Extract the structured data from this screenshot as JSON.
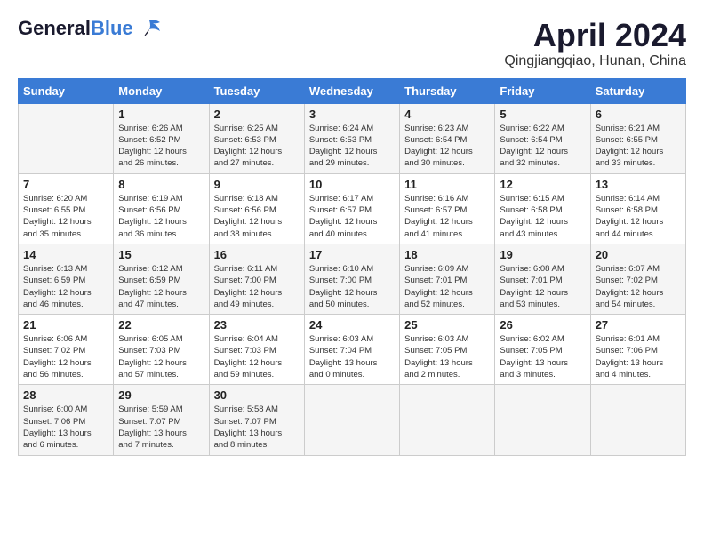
{
  "header": {
    "logo_line1": "General",
    "logo_line2": "Blue",
    "title": "April 2024",
    "subtitle": "Qingjiangqiao, Hunan, China"
  },
  "days_of_week": [
    "Sunday",
    "Monday",
    "Tuesday",
    "Wednesday",
    "Thursday",
    "Friday",
    "Saturday"
  ],
  "weeks": [
    [
      {
        "day": "",
        "info": ""
      },
      {
        "day": "1",
        "info": "Sunrise: 6:26 AM\nSunset: 6:52 PM\nDaylight: 12 hours\nand 26 minutes."
      },
      {
        "day": "2",
        "info": "Sunrise: 6:25 AM\nSunset: 6:53 PM\nDaylight: 12 hours\nand 27 minutes."
      },
      {
        "day": "3",
        "info": "Sunrise: 6:24 AM\nSunset: 6:53 PM\nDaylight: 12 hours\nand 29 minutes."
      },
      {
        "day": "4",
        "info": "Sunrise: 6:23 AM\nSunset: 6:54 PM\nDaylight: 12 hours\nand 30 minutes."
      },
      {
        "day": "5",
        "info": "Sunrise: 6:22 AM\nSunset: 6:54 PM\nDaylight: 12 hours\nand 32 minutes."
      },
      {
        "day": "6",
        "info": "Sunrise: 6:21 AM\nSunset: 6:55 PM\nDaylight: 12 hours\nand 33 minutes."
      }
    ],
    [
      {
        "day": "7",
        "info": "Sunrise: 6:20 AM\nSunset: 6:55 PM\nDaylight: 12 hours\nand 35 minutes."
      },
      {
        "day": "8",
        "info": "Sunrise: 6:19 AM\nSunset: 6:56 PM\nDaylight: 12 hours\nand 36 minutes."
      },
      {
        "day": "9",
        "info": "Sunrise: 6:18 AM\nSunset: 6:56 PM\nDaylight: 12 hours\nand 38 minutes."
      },
      {
        "day": "10",
        "info": "Sunrise: 6:17 AM\nSunset: 6:57 PM\nDaylight: 12 hours\nand 40 minutes."
      },
      {
        "day": "11",
        "info": "Sunrise: 6:16 AM\nSunset: 6:57 PM\nDaylight: 12 hours\nand 41 minutes."
      },
      {
        "day": "12",
        "info": "Sunrise: 6:15 AM\nSunset: 6:58 PM\nDaylight: 12 hours\nand 43 minutes."
      },
      {
        "day": "13",
        "info": "Sunrise: 6:14 AM\nSunset: 6:58 PM\nDaylight: 12 hours\nand 44 minutes."
      }
    ],
    [
      {
        "day": "14",
        "info": "Sunrise: 6:13 AM\nSunset: 6:59 PM\nDaylight: 12 hours\nand 46 minutes."
      },
      {
        "day": "15",
        "info": "Sunrise: 6:12 AM\nSunset: 6:59 PM\nDaylight: 12 hours\nand 47 minutes."
      },
      {
        "day": "16",
        "info": "Sunrise: 6:11 AM\nSunset: 7:00 PM\nDaylight: 12 hours\nand 49 minutes."
      },
      {
        "day": "17",
        "info": "Sunrise: 6:10 AM\nSunset: 7:00 PM\nDaylight: 12 hours\nand 50 minutes."
      },
      {
        "day": "18",
        "info": "Sunrise: 6:09 AM\nSunset: 7:01 PM\nDaylight: 12 hours\nand 52 minutes."
      },
      {
        "day": "19",
        "info": "Sunrise: 6:08 AM\nSunset: 7:01 PM\nDaylight: 12 hours\nand 53 minutes."
      },
      {
        "day": "20",
        "info": "Sunrise: 6:07 AM\nSunset: 7:02 PM\nDaylight: 12 hours\nand 54 minutes."
      }
    ],
    [
      {
        "day": "21",
        "info": "Sunrise: 6:06 AM\nSunset: 7:02 PM\nDaylight: 12 hours\nand 56 minutes."
      },
      {
        "day": "22",
        "info": "Sunrise: 6:05 AM\nSunset: 7:03 PM\nDaylight: 12 hours\nand 57 minutes."
      },
      {
        "day": "23",
        "info": "Sunrise: 6:04 AM\nSunset: 7:03 PM\nDaylight: 12 hours\nand 59 minutes."
      },
      {
        "day": "24",
        "info": "Sunrise: 6:03 AM\nSunset: 7:04 PM\nDaylight: 13 hours\nand 0 minutes."
      },
      {
        "day": "25",
        "info": "Sunrise: 6:03 AM\nSunset: 7:05 PM\nDaylight: 13 hours\nand 2 minutes."
      },
      {
        "day": "26",
        "info": "Sunrise: 6:02 AM\nSunset: 7:05 PM\nDaylight: 13 hours\nand 3 minutes."
      },
      {
        "day": "27",
        "info": "Sunrise: 6:01 AM\nSunset: 7:06 PM\nDaylight: 13 hours\nand 4 minutes."
      }
    ],
    [
      {
        "day": "28",
        "info": "Sunrise: 6:00 AM\nSunset: 7:06 PM\nDaylight: 13 hours\nand 6 minutes."
      },
      {
        "day": "29",
        "info": "Sunrise: 5:59 AM\nSunset: 7:07 PM\nDaylight: 13 hours\nand 7 minutes."
      },
      {
        "day": "30",
        "info": "Sunrise: 5:58 AM\nSunset: 7:07 PM\nDaylight: 13 hours\nand 8 minutes."
      },
      {
        "day": "",
        "info": ""
      },
      {
        "day": "",
        "info": ""
      },
      {
        "day": "",
        "info": ""
      },
      {
        "day": "",
        "info": ""
      }
    ]
  ]
}
